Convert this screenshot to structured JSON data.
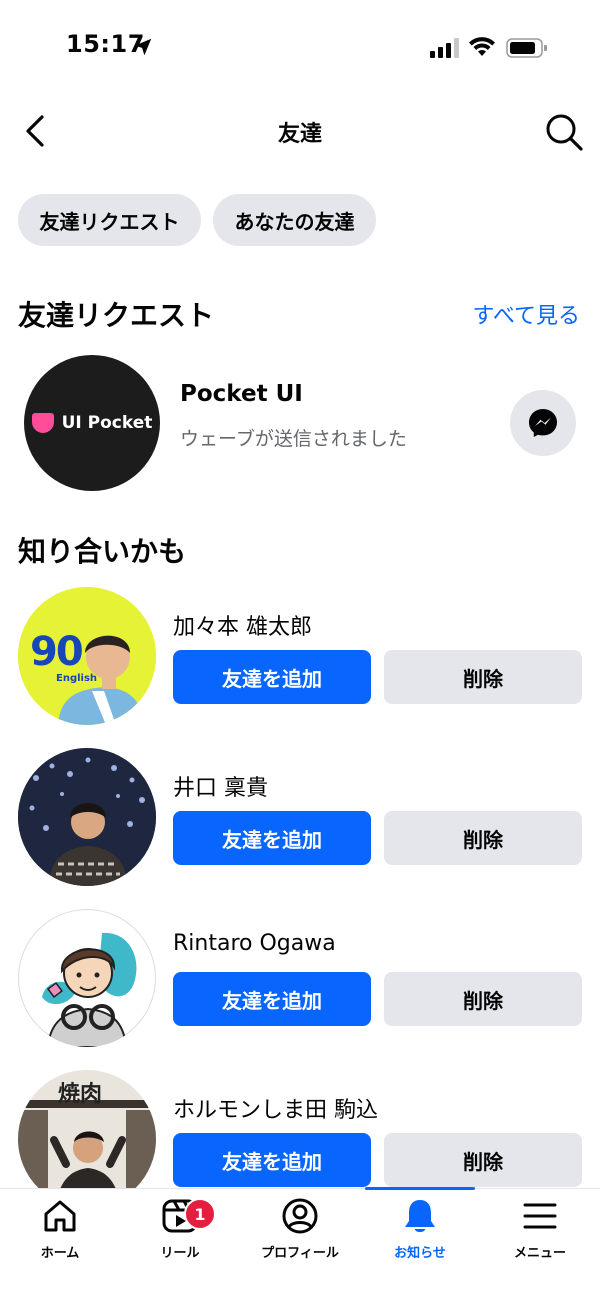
{
  "status_bar": {
    "time": "15:17"
  },
  "header": {
    "title": "友達"
  },
  "chips": [
    {
      "label": "友達リクエスト"
    },
    {
      "label": "あなたの友達"
    }
  ],
  "requests": {
    "heading": "友達リクエスト",
    "see_all": "すべて見る",
    "items": [
      {
        "name": "Pocket UI",
        "subtitle": "ウェーブが送信されました",
        "avatar_text": "UI Pocket"
      }
    ]
  },
  "suggestions": {
    "heading": "知り合いかも",
    "items": [
      {
        "name": "加々本 雄太郎",
        "add_label": "友達を追加",
        "remove_label": "削除",
        "avatar_text": "90",
        "avatar_subtext": "English"
      },
      {
        "name": "井口 稟貴",
        "add_label": "友達を追加",
        "remove_label": "削除"
      },
      {
        "name": "Rintaro Ogawa",
        "add_label": "友達を追加",
        "remove_label": "削除"
      },
      {
        "name": "ホルモンしま田 駒込",
        "add_label": "友達を追加",
        "remove_label": "削除",
        "avatar_text": "焼肉"
      }
    ]
  },
  "tabbar": {
    "items": [
      {
        "label": "ホーム",
        "icon": "home-icon"
      },
      {
        "label": "リール",
        "icon": "reels-icon",
        "badge": "1"
      },
      {
        "label": "プロフィール",
        "icon": "profile-icon"
      },
      {
        "label": "お知らせ",
        "icon": "bell-icon",
        "active": true
      },
      {
        "label": "メニュー",
        "icon": "menu-icon"
      }
    ]
  },
  "colors": {
    "accent": "#0866ff",
    "chip_bg": "#e4e6eb",
    "badge": "#e41e3f",
    "secondary_text": "#65676b"
  }
}
